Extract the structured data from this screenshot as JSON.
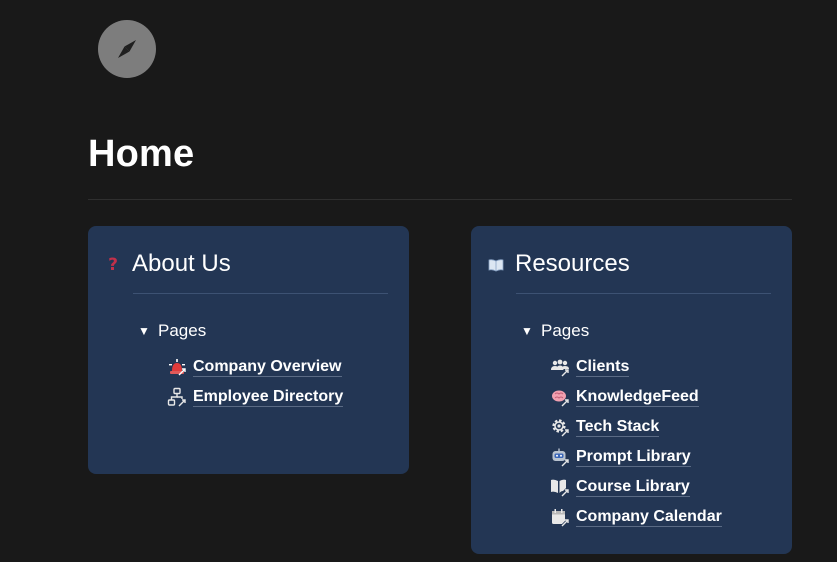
{
  "page": {
    "icon": "compass-icon",
    "title": "Home"
  },
  "colors": {
    "background": "#191919",
    "callout_bg": "#233654",
    "icon_circle": "#7d7d7d",
    "question_mark": "#c2304a"
  },
  "about": {
    "icon": "question-mark-icon",
    "icon_glyph": "?",
    "title": "About Us",
    "toggle_label": "Pages",
    "links": [
      {
        "icon": "siren-icon",
        "label": "Company Overview"
      },
      {
        "icon": "org-chart-icon",
        "label": "Employee Directory"
      }
    ]
  },
  "resources": {
    "icon": "open-book-icon",
    "title": "Resources",
    "toggle_label": "Pages",
    "links": [
      {
        "icon": "people-icon",
        "label": "Clients"
      },
      {
        "icon": "brain-icon",
        "label": "KnowledgeFeed"
      },
      {
        "icon": "gear-icon",
        "label": "Tech Stack"
      },
      {
        "icon": "robot-icon",
        "label": "Prompt Library"
      },
      {
        "icon": "book-icon",
        "label": "Course Library"
      },
      {
        "icon": "calendar-icon",
        "label": "Company Calendar"
      }
    ]
  }
}
